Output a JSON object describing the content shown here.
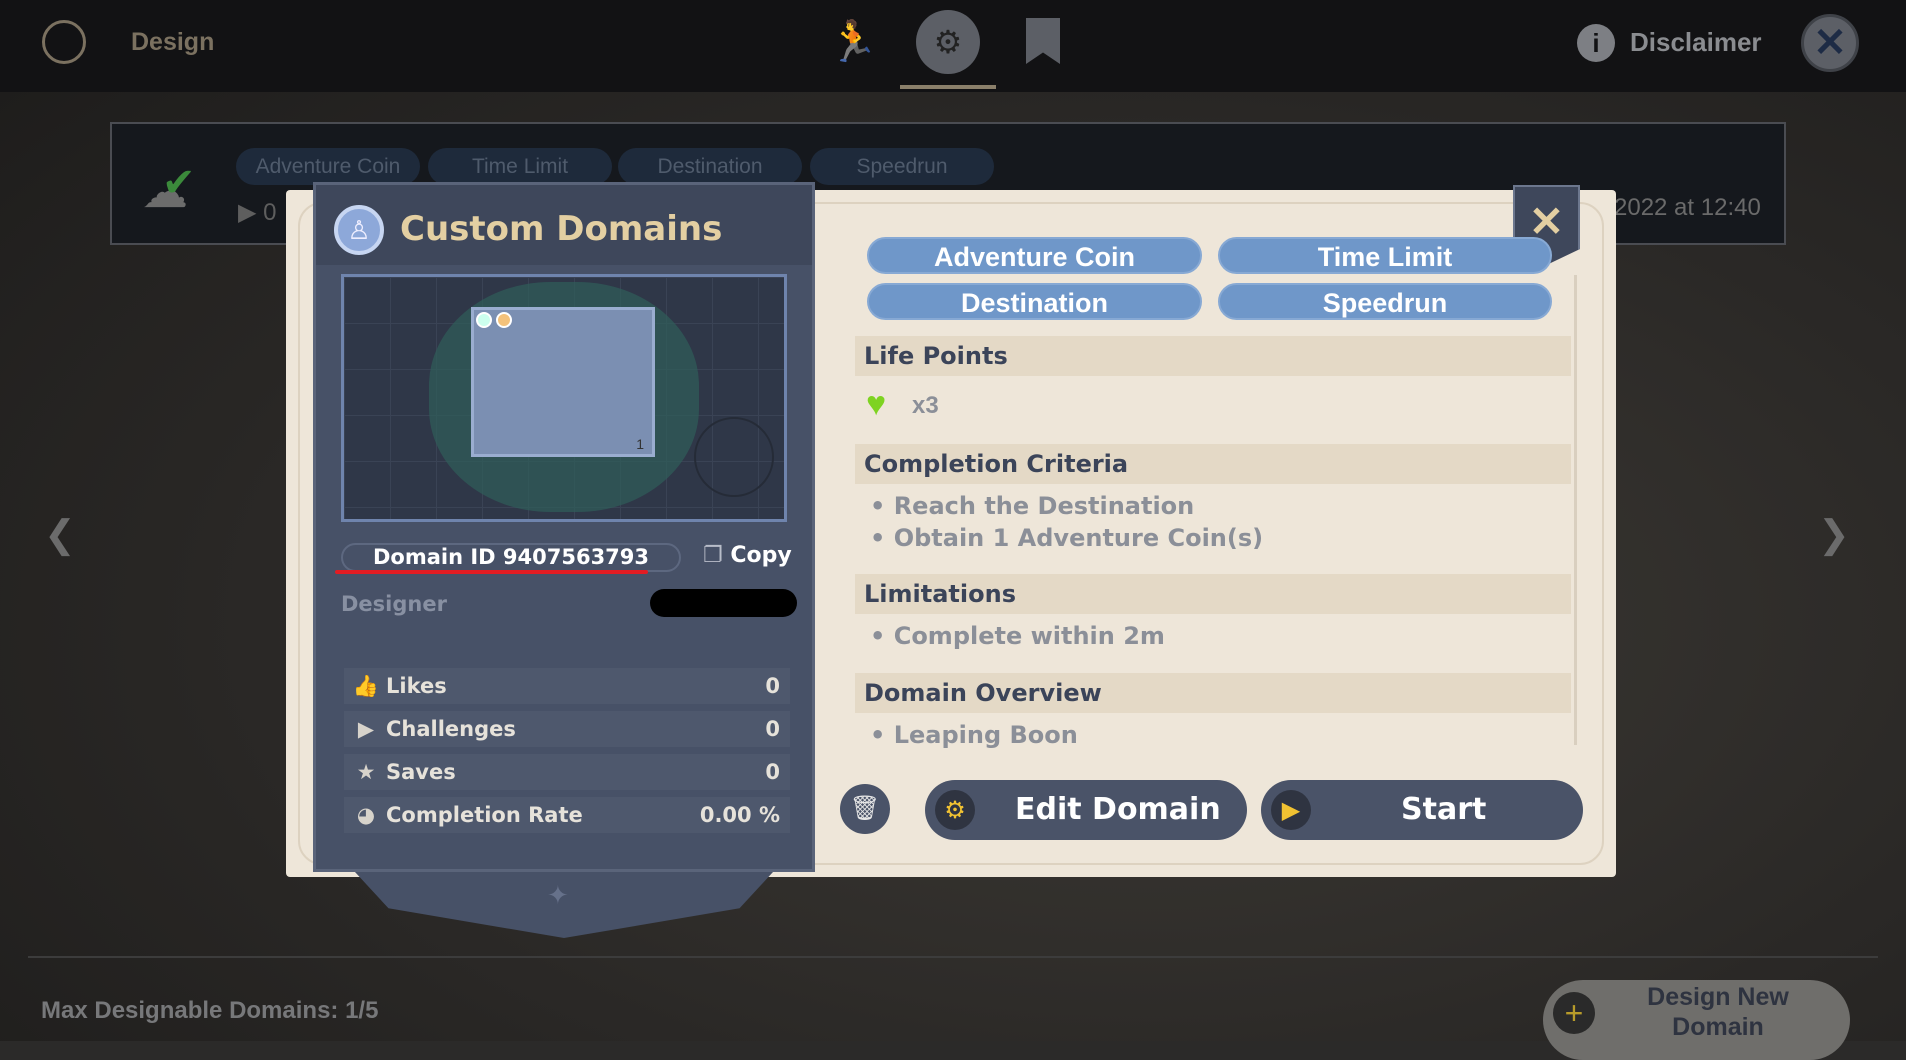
{
  "header": {
    "title": "Design",
    "disclaimer": "Disclaimer",
    "nav": [
      "runner-icon",
      "map-gear-icon",
      "bookmark-star-icon"
    ],
    "active_nav": 1
  },
  "background_card": {
    "tags": [
      "Adventure Coin",
      "Time Limit",
      "Destination",
      "Speedrun"
    ],
    "partial_count": "0",
    "date_fragment": "2022 at 12:40"
  },
  "left_panel": {
    "title": "Custom Domains",
    "domain_id": "Domain ID 9407563793",
    "copy": "Copy",
    "designer_label": "Designer",
    "stats": [
      {
        "icon": "thumbs-up-icon",
        "label": "Likes",
        "value": "0"
      },
      {
        "icon": "play-icon",
        "label": "Challenges",
        "value": "0"
      },
      {
        "icon": "star-icon",
        "label": "Saves",
        "value": "0"
      },
      {
        "icon": "pie-icon",
        "label": "Completion Rate",
        "value": "0.00 %"
      }
    ],
    "map_floor_label": "1"
  },
  "right_panel": {
    "tags": [
      "Adventure Coin",
      "Time Limit",
      "Destination",
      "Speedrun"
    ],
    "life_points": {
      "title": "Life Points",
      "value": "x3"
    },
    "completion": {
      "title": "Completion Criteria",
      "items": [
        "Reach the Destination",
        "Obtain 1 Adventure Coin(s)"
      ]
    },
    "limitations": {
      "title": "Limitations",
      "items": [
        "Complete within 2m"
      ]
    },
    "overview": {
      "title": "Domain Overview",
      "items": [
        "Leaping Boon"
      ]
    },
    "edit": "Edit Domain",
    "start": "Start"
  },
  "footer": {
    "max_domains": "Max Designable Domains: 1/5",
    "design_new": "Design New Domain"
  },
  "colors": {
    "tag": "#6f97c9",
    "panel": "#475167",
    "cream": "#eee6d9",
    "title_gold": "#e3cfa2",
    "heart": "#7ed321",
    "accent_yellow": "#f1c232"
  }
}
